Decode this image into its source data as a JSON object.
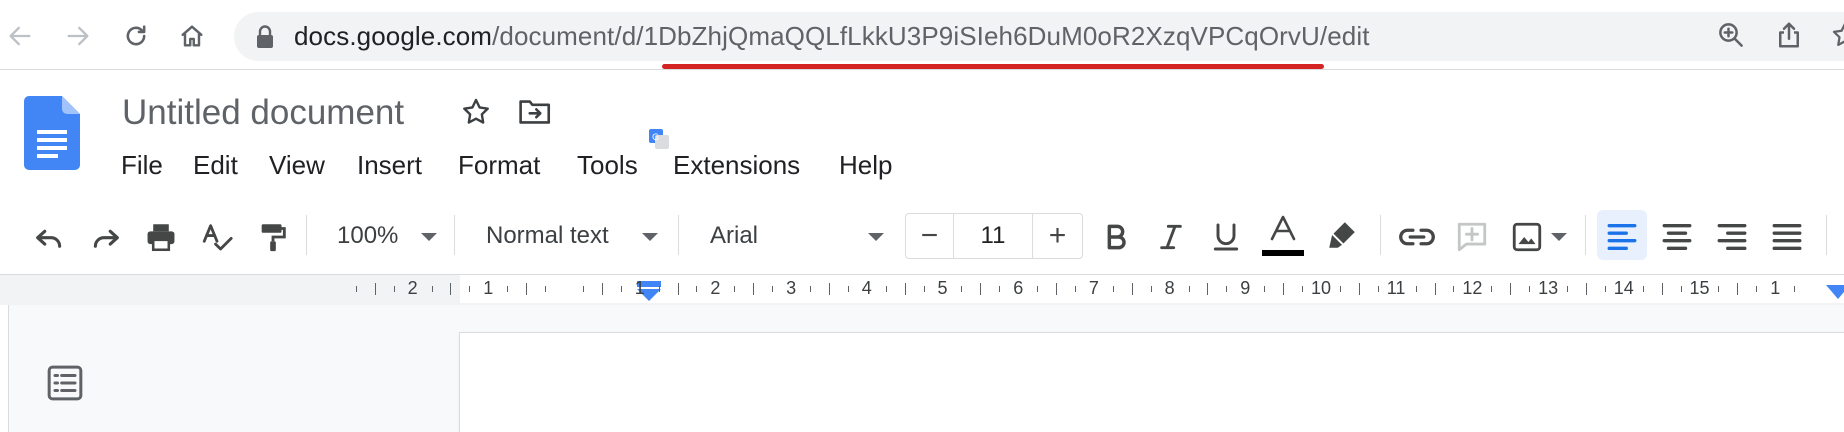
{
  "browser": {
    "url_host": "docs.google.com",
    "url_path": "/document/d/1DbZhjQmaQQLfLkkU3P9iSIeh6DuM0oR2XzqVPCqOrvU/edit",
    "icons": [
      "back-arrow-icon",
      "forward-arrow-icon",
      "reload-icon",
      "home-icon",
      "lock-icon",
      "zoom-icon",
      "share-icon",
      "bookmark-star-icon"
    ],
    "annotation_color": "#d42424"
  },
  "document": {
    "title": "Untitled document",
    "icons": [
      "docs-logo-icon",
      "star-icon",
      "move-to-folder-icon",
      "translate-icon"
    ]
  },
  "menu": {
    "items": [
      "File",
      "Edit",
      "View",
      "Insert",
      "Format",
      "Tools",
      "Extensions",
      "Help"
    ]
  },
  "toolbar": {
    "zoom": "100%",
    "style": "Normal text",
    "font": "Arial",
    "font_size": "11",
    "minus_label": "−",
    "plus_label": "+",
    "text_color_bar": "#000000",
    "accent": "#1a73e8"
  },
  "ruler": {
    "left_numbers": [
      "2",
      "1"
    ],
    "right_numbers": [
      "1",
      "2",
      "3",
      "4",
      "5",
      "6",
      "7",
      "8",
      "9",
      "10",
      "11",
      "12",
      "13",
      "14",
      "15",
      "1"
    ]
  }
}
